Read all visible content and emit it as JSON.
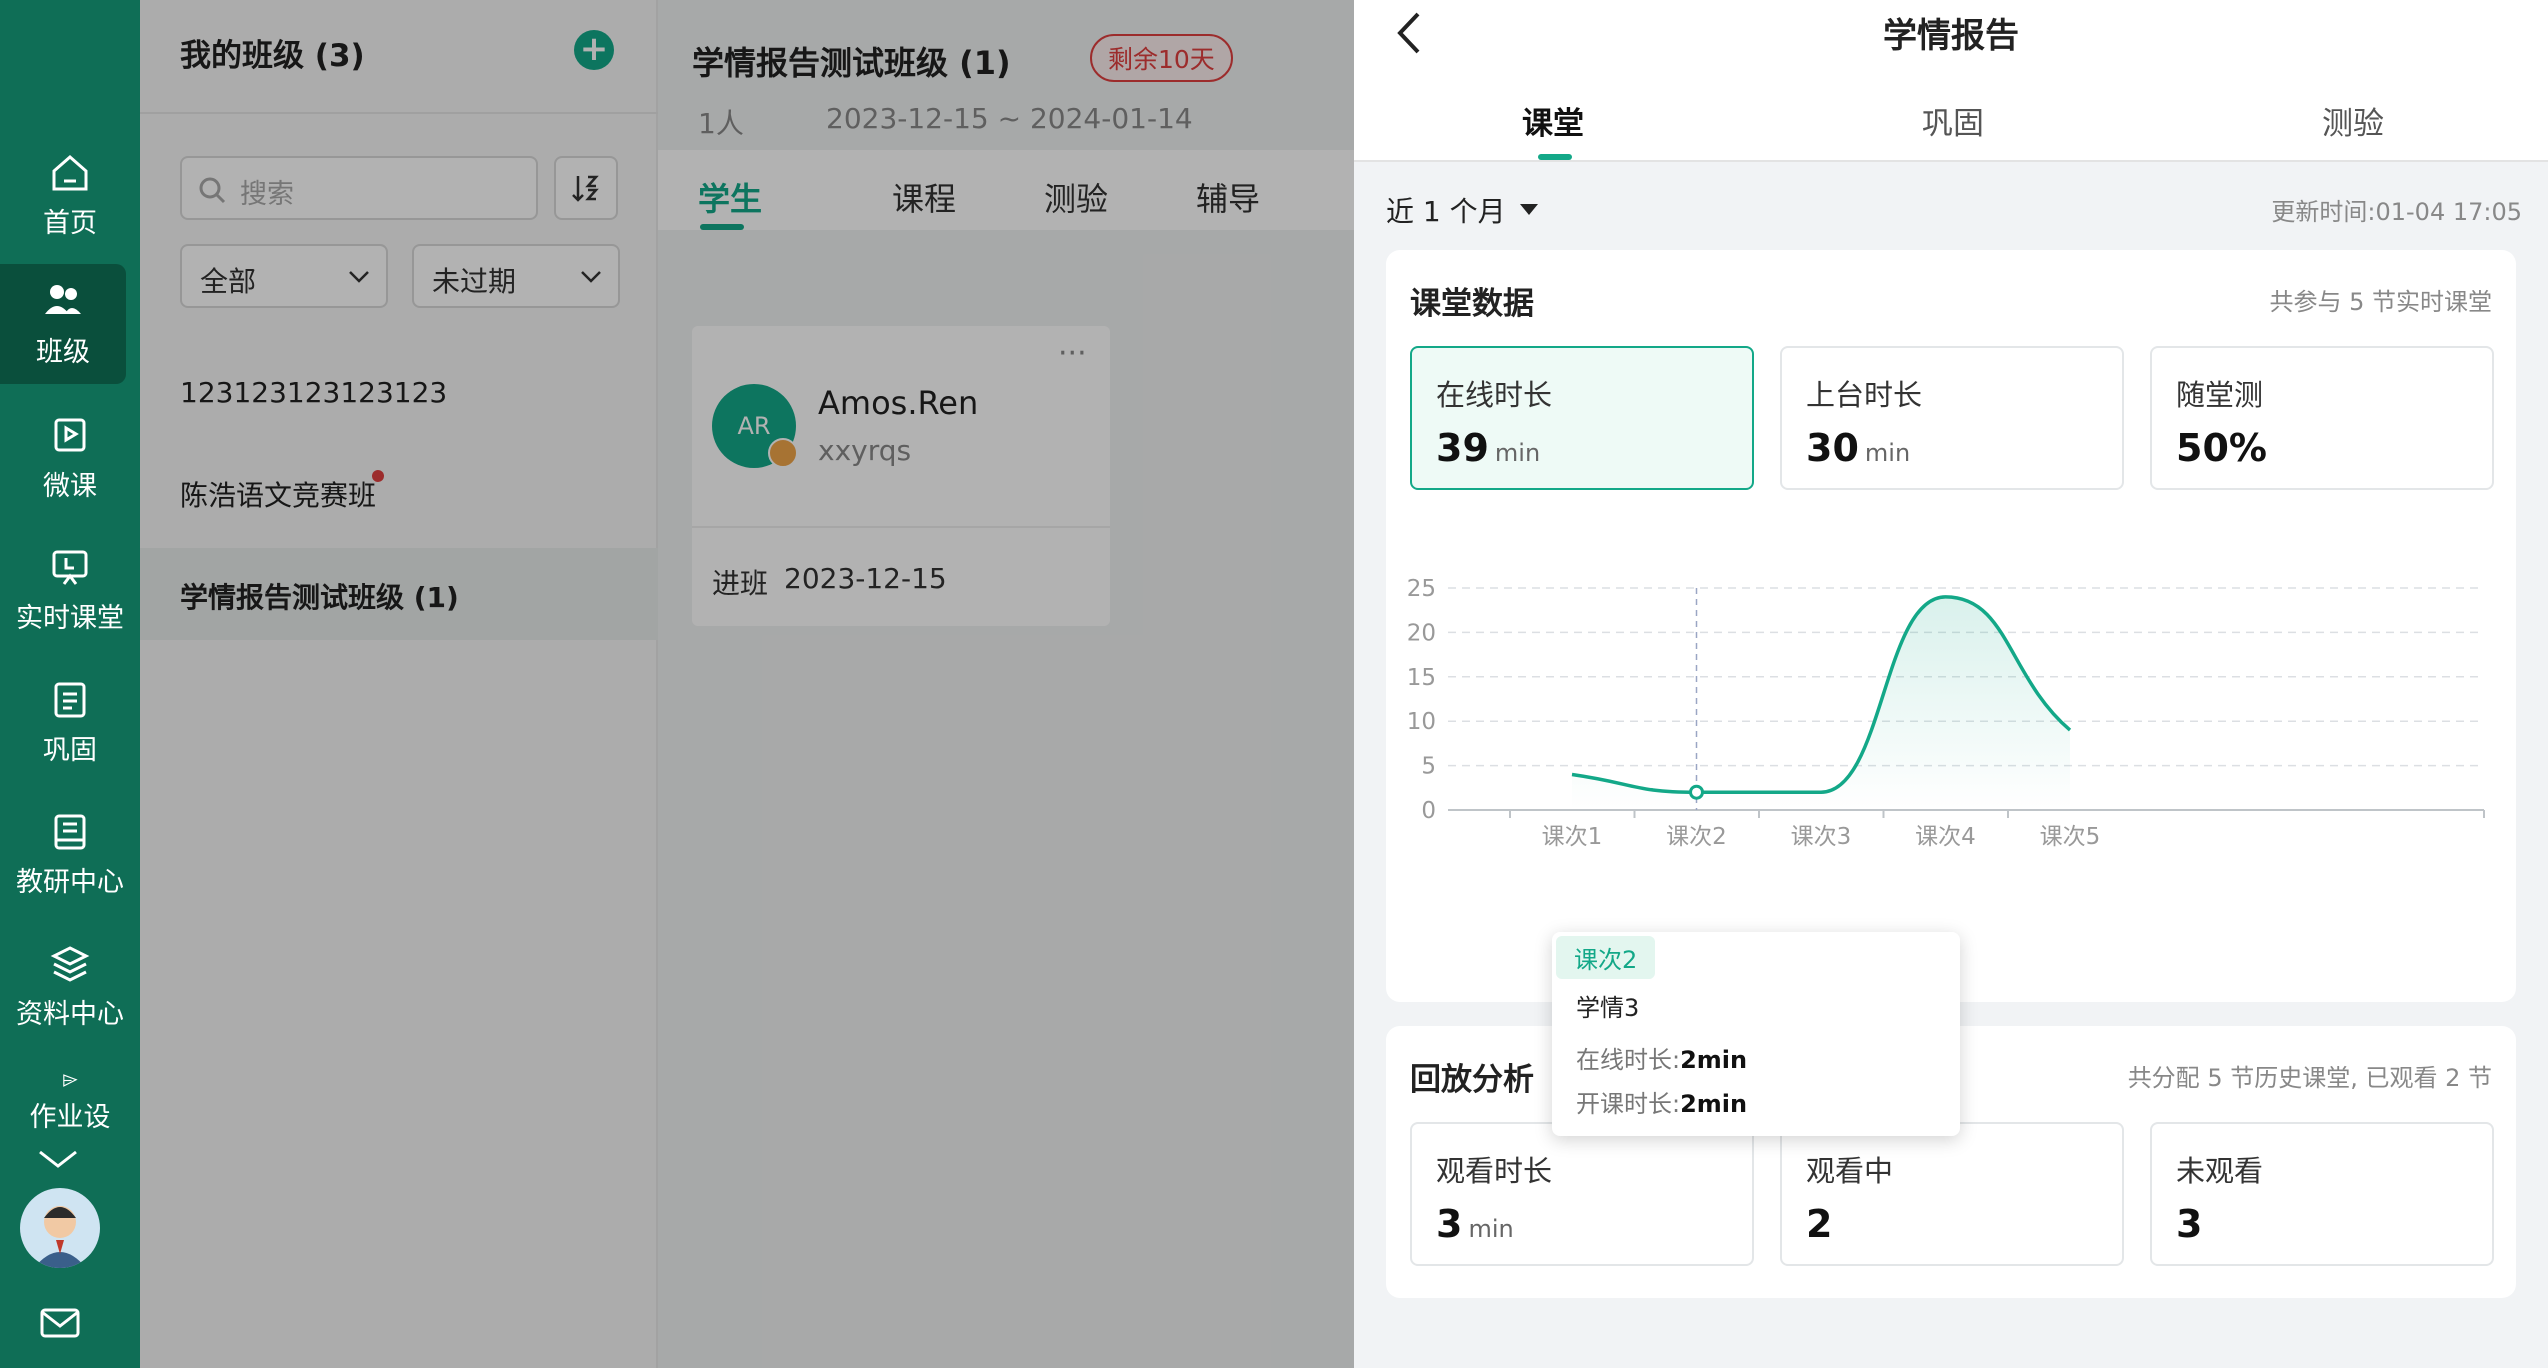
{
  "colors": {
    "accent": "#13a888",
    "nav_bg": "#0f6e56",
    "badge": "#e04040"
  },
  "nav": {
    "items": [
      {
        "label": "首页",
        "icon": "home-icon"
      },
      {
        "label": "班级",
        "icon": "class-icon"
      },
      {
        "label": "微课",
        "icon": "microlesson-icon"
      },
      {
        "label": "实时课堂",
        "icon": "live-class-icon"
      },
      {
        "label": "巩固",
        "icon": "practice-icon"
      },
      {
        "label": "教研中心",
        "icon": "research-icon"
      },
      {
        "label": "资料中心",
        "icon": "materials-icon"
      },
      {
        "label": "作业设",
        "icon": "homework-icon"
      }
    ]
  },
  "classes": {
    "title": "我的班级 (3)",
    "search_placeholder": "搜索",
    "filter_all": "全部",
    "filter_status": "未过期",
    "list": [
      "123123123123123",
      "陈浩语文竞赛班",
      "学情报告测试班级 (1)"
    ]
  },
  "class_detail": {
    "title": "学情报告测试班级 (1)",
    "badge": "剩余10天",
    "count": "1人",
    "date_range": "2023-12-15 ~ 2024-01-14",
    "tabs": [
      "学生",
      "课程",
      "测验",
      "辅导"
    ],
    "student": {
      "initials": "AR",
      "name": "Amos.Ren",
      "account": "xxyrqs",
      "join_label": "进班",
      "join_date": "2023-12-15",
      "more": "···"
    }
  },
  "report": {
    "title": "学情报告",
    "tabs": [
      "课堂",
      "巩固",
      "测验"
    ],
    "period": "近 1 个月",
    "update_label": "更新时间:",
    "update_time": "01-04 17:05",
    "classroom": {
      "title": "课堂数据",
      "summary": "共参与 5 节实时课堂",
      "stats": [
        {
          "label": "在线时长",
          "value": "39",
          "unit": "min"
        },
        {
          "label": "上台时长",
          "value": "30",
          "unit": "min"
        },
        {
          "label": "随堂测",
          "value": "50%",
          "unit": ""
        }
      ]
    },
    "tooltip": {
      "category": "课次2",
      "lesson": "学情3",
      "online_label": "在线时长:",
      "online_value": "2min",
      "open_label": "开课时长:",
      "open_value": "2min"
    },
    "playback": {
      "title": "回放分析",
      "summary": "共分配 5 节历史课堂, 已观看 2 节",
      "stats": [
        {
          "label": "观看时长",
          "value": "3",
          "unit": "min"
        },
        {
          "label": "观看中",
          "value": "2",
          "unit": ""
        },
        {
          "label": "未观看",
          "value": "3",
          "unit": ""
        }
      ]
    }
  },
  "chart_data": {
    "type": "line",
    "categories": [
      "课次1",
      "课次2",
      "课次3",
      "课次4",
      "课次5"
    ],
    "series": [
      {
        "values": [
          4,
          2,
          2,
          24,
          9
        ]
      }
    ],
    "ylim": [
      0,
      25
    ],
    "yticks": [
      0,
      5,
      10,
      15,
      20,
      25
    ],
    "grid": true,
    "highlight_index": 1
  }
}
